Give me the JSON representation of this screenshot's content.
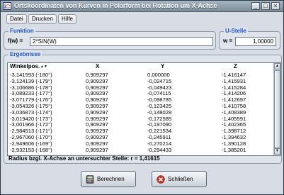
{
  "window": {
    "title": "Ortskoordinaten von Kurven in Polarform bei Rotation um X-Achse",
    "minimize": "_",
    "maximize": "□",
    "close": "×"
  },
  "menu": [
    {
      "label": "Datei"
    },
    {
      "label": "Drucken"
    },
    {
      "label": "Hilfe"
    }
  ],
  "funktion": {
    "legend": "Funktion",
    "label": "f(w) =",
    "value": "2*SIN(W)"
  },
  "ustelle": {
    "legend": "U-Stelle",
    "label": "w =",
    "value": "1,00000"
  },
  "ergebnisse": {
    "legend": "Ergebnisse",
    "headers": {
      "winkel": "Winkelpos.",
      "sort_icon": "▲▼",
      "x": "X",
      "y": "Y",
      "z": "Z"
    },
    "rows": [
      {
        "w": "-3,141593 (-180°)",
        "x": "0,909297",
        "y": "0,000000",
        "z": "-1,416147"
      },
      {
        "w": "-3,124139 (-179°)",
        "x": "0,909297",
        "y": "-0,024715",
        "z": "-1,415931"
      },
      {
        "w": "-3,106686 (-178°)",
        "x": "0,909297",
        "y": "-0,049423",
        "z": "-1,415284"
      },
      {
        "w": "-3,089233 (-177°)",
        "x": "0,909297",
        "y": "-0,074115",
        "z": "-1,414206"
      },
      {
        "w": "-3,071779 (-176°)",
        "x": "0,909297",
        "y": "-0,098785",
        "z": "-1,412697"
      },
      {
        "w": "-3,054326 (-175°)",
        "x": "0,909297",
        "y": "-0,123425",
        "z": "-1,410758"
      },
      {
        "w": "-3,036873 (-174°)",
        "x": "0,909297",
        "y": "-0,148028",
        "z": "-1,408389"
      },
      {
        "w": "-3,019420 (-173°)",
        "x": "0,909297",
        "y": "-0,172585",
        "z": "-1,405591"
      },
      {
        "w": "-3,001966 (-172°)",
        "x": "0,909297",
        "y": "-0,197090",
        "z": "-1,402365"
      },
      {
        "w": "-2,984513 (-171°)",
        "x": "0,909297",
        "y": "-0,221534",
        "z": "-1,398712"
      },
      {
        "w": "-2,967060 (-170°)",
        "x": "0,909297",
        "y": "-0,245911",
        "z": "-1,394632"
      },
      {
        "w": "-2,949606 (-169°)",
        "x": "0,909297",
        "y": "-0,270214",
        "z": "-1,390128"
      },
      {
        "w": "-2,932153 (-168°)",
        "x": "0,909297",
        "y": "-0,294433",
        "z": "-1,385201"
      }
    ],
    "status": "Radius bzgl. X-Achse an untersuchter Stelle:  r = 1,41615"
  },
  "buttons": {
    "berechnen": "Berechnen",
    "schliessen": "Schließen"
  },
  "colors": {
    "legend": "#1a56c8",
    "close_icon": "#c0392b",
    "calc_icon": "#4a4a4a"
  }
}
